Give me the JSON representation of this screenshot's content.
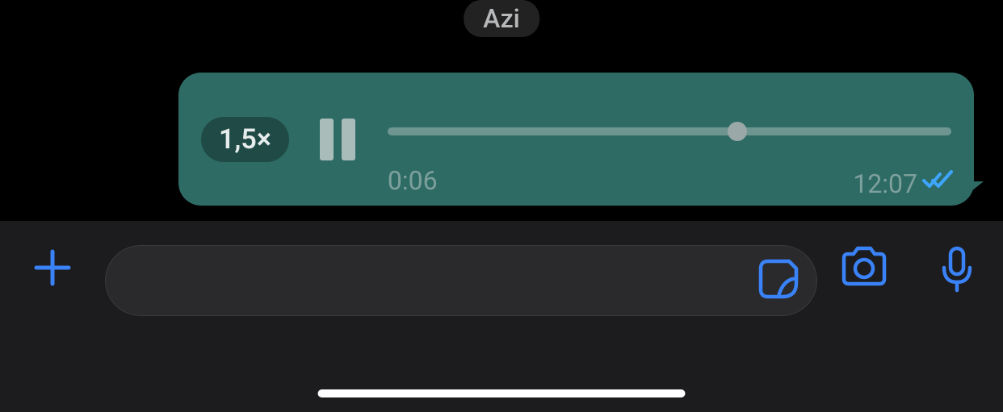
{
  "date_chip": "Azi",
  "voice_message": {
    "speed_label": "1,5×",
    "elapsed": "0:06",
    "sent_time": "12:07",
    "progress_percent": 62,
    "read_status": "read"
  },
  "colors": {
    "accent_blue": "#3a82f7",
    "tick_blue": "#3ea6ff"
  }
}
